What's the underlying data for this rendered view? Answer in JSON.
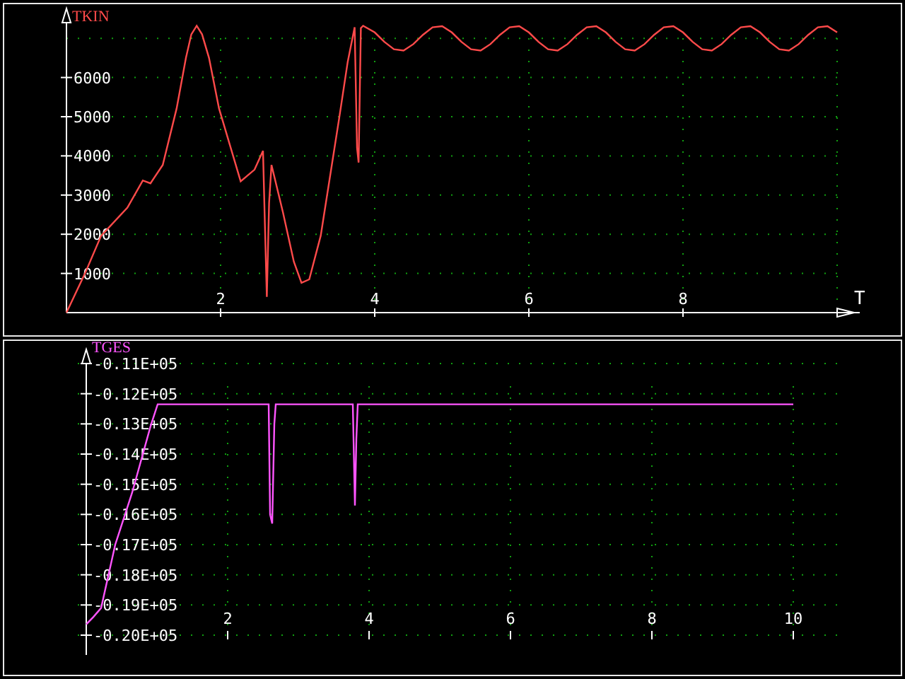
{
  "panels": [
    {
      "chart_data": {
        "type": "line",
        "grid": true,
        "ylabel": "TKIN",
        "xlabel": "T",
        "xlim": [
          0,
          10
        ],
        "ylim": [
          0,
          7400
        ],
        "xticks": [
          2,
          4,
          6,
          8
        ],
        "yticks": [
          1000,
          2000,
          3000,
          4000,
          5000,
          6000
        ],
        "x": [
          0,
          0.24,
          0.45,
          0.79,
          0.99,
          1.09,
          1.25,
          1.43,
          1.55,
          1.62,
          1.69,
          1.76,
          1.85,
          1.98,
          2.26,
          2.44,
          2.55,
          2.57,
          2.6,
          2.63,
          2.66,
          2.81,
          2.95,
          3.05,
          3.15,
          3.3,
          3.54,
          3.65,
          3.74,
          3.77,
          3.79,
          3.82,
          3.85,
          4.0,
          4.125,
          4.25,
          4.375,
          4.5,
          4.625,
          4.75,
          4.875,
          5.0,
          5.125,
          5.25,
          5.375,
          5.5,
          5.625,
          5.75,
          5.875,
          6.0,
          6.125,
          6.25,
          6.375,
          6.5,
          6.625,
          6.75,
          6.875,
          7.0,
          7.125,
          7.25,
          7.375,
          7.5,
          7.625,
          7.75,
          7.875,
          8.0,
          8.125,
          8.25,
          8.375,
          8.5,
          8.625,
          8.75,
          8.875,
          9.0,
          9.125,
          9.25,
          9.375,
          9.5,
          9.625,
          9.75,
          9.875,
          10.0
        ],
        "series": [
          {
            "color": "#ff4a4a",
            "values": [
              0,
              1000,
              1960,
              2680,
              3370,
              3300,
              3770,
              5210,
              6500,
              7100,
              7320,
              7100,
              6500,
              5210,
              3350,
              3650,
              4130,
              2570,
              400,
              2800,
              3770,
              2560,
              1300,
              760,
              850,
              1960,
              4970,
              6400,
              7280,
              4200,
              3830,
              7260,
              7320,
              7150,
              6910,
              6720,
              6690,
              6850,
              7090,
              7280,
              7310,
              7150,
              6910,
              6720,
              6690,
              6850,
              7090,
              7280,
              7310,
              7150,
              6910,
              6720,
              6690,
              6850,
              7090,
              7280,
              7310,
              7150,
              6910,
              6720,
              6690,
              6850,
              7090,
              7280,
              7310,
              7150,
              6910,
              6720,
              6690,
              6850,
              7090,
              7280,
              7310,
              7150,
              6910,
              6720,
              6690,
              6850,
              7090,
              7280,
              7310,
              7150
            ]
          }
        ]
      }
    },
    {
      "chart_data": {
        "type": "line",
        "grid": true,
        "ylabel": "TGES",
        "xlim": [
          0,
          10
        ],
        "ylim": [
          -20000,
          -11000
        ],
        "xticks": [
          2,
          4,
          6,
          8,
          10
        ],
        "yticks": [
          {
            "value": -11000,
            "label": "-0.11E+05"
          },
          {
            "value": -12000,
            "label": "-0.12E+05"
          },
          {
            "value": -13000,
            "label": "-0.13E+05"
          },
          {
            "value": -14000,
            "label": "-0.14E+05"
          },
          {
            "value": -15000,
            "label": "-0.15E+05"
          },
          {
            "value": -16000,
            "label": "-0.16E+05"
          },
          {
            "value": -17000,
            "label": "-0.17E+05"
          },
          {
            "value": -18000,
            "label": "-0.18E+05"
          },
          {
            "value": -19000,
            "label": "-0.19E+05"
          },
          {
            "value": -20000,
            "label": "-0.20E+05"
          }
        ],
        "x": [
          0,
          0.1,
          0.21,
          0.41,
          0.65,
          0.91,
          1.01,
          2.58,
          2.6,
          2.63,
          2.66,
          2.68,
          3.77,
          3.8,
          3.82,
          3.84,
          10
        ],
        "series": [
          {
            "color": "#ff55ff",
            "values": [
              -19640,
              -19400,
              -19100,
              -17000,
              -15270,
              -13070,
              -12350,
              -12350,
              -16000,
              -16300,
              -13000,
              -12350,
              -12350,
              -15700,
              -13500,
              -12350,
              -12350
            ]
          }
        ]
      }
    }
  ]
}
